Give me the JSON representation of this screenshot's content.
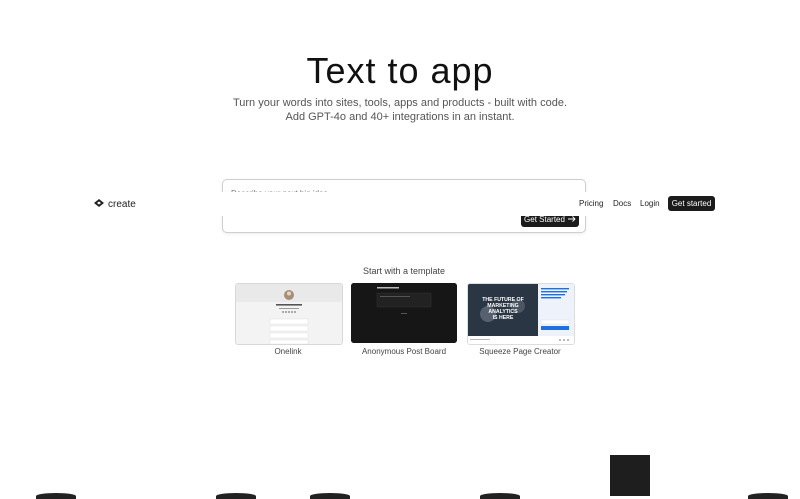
{
  "hero": {
    "title": "Text to app",
    "subtitle_line1": "Turn your words into sites, tools, apps and products - built with code.",
    "subtitle_line2": "Add GPT-4o and 40+ integrations in an instant."
  },
  "prompt": {
    "placeholder": "Describe your next big idea",
    "submit_label": "Get Started",
    "submit_icon": "arrow-right-icon"
  },
  "nav": {
    "logo_text": "create",
    "logo_icon": "create-logo-icon",
    "links": [
      "Pricing",
      "Docs",
      "Login"
    ],
    "cta_label": "Get started"
  },
  "templates": {
    "heading": "Start with a template",
    "items": [
      {
        "name": "Onelink",
        "profile_name": "Cynthia Barnes"
      },
      {
        "name": "Anonymous Post Board",
        "header_text": "Post your truth"
      },
      {
        "name": "Squeeze Page Creator",
        "headline": "THE FUTURE OF MARKETING ANALYTICS IS HERE"
      }
    ]
  },
  "colors": {
    "background": "#ffffff",
    "button_dark": "#1b1b1b",
    "text_primary": "#111111",
    "text_secondary": "#555555",
    "accent_blue": "#1e6fe0"
  }
}
